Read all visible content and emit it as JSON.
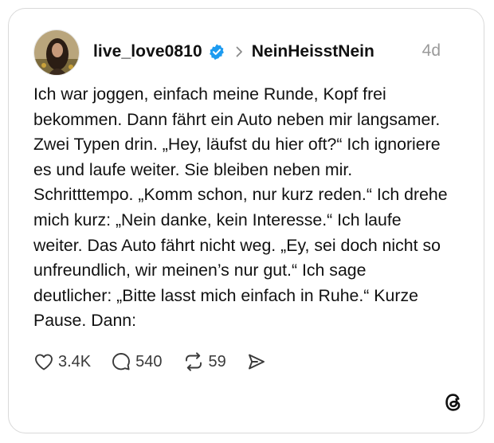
{
  "post": {
    "username": "live_love0810",
    "community": "NeinHeisstNein",
    "timestamp": "4d",
    "text": "Ich war joggen, einfach meine Runde, Kopf frei bekommen. Dann fährt ein Auto neben mir langsamer. Zwei Typen drin. „Hey, läufst du hier oft?“ Ich ignoriere es und laufe weiter. Sie bleiben neben mir. Schritttempo. „Komm schon, nur kurz reden.“ Ich drehe mich kurz: „Nein danke, kein Interesse.“ Ich laufe weiter. Das Auto fährt nicht weg. „Ey, sei doch nicht so unfreundlich, wir meinen’s nur gut.“ Ich sage deutlicher: „Bitte lasst mich einfach in Ruhe.“ Kurze Pause. Dann:"
  },
  "actions": {
    "likes": "3.4K",
    "replies": "540",
    "reposts": "59"
  },
  "icons": {
    "verified": "verified-badge-icon",
    "separator": "chevron-right-icon",
    "like": "heart-icon",
    "reply": "speech-bubble-icon",
    "repost": "repost-arrows-icon",
    "share": "send-icon",
    "brand": "threads-logo-icon"
  },
  "colors": {
    "verified": "#1d9bf0",
    "text": "#111111",
    "muted": "#9a9a9a",
    "border": "#d9d9d9"
  }
}
